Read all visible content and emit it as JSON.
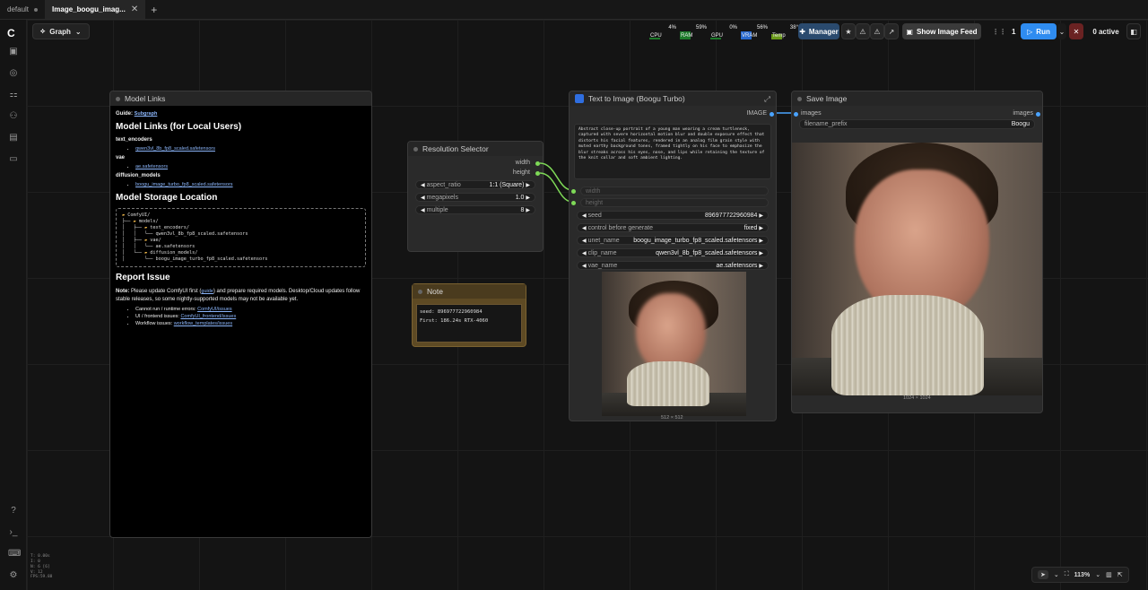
{
  "tabs": [
    {
      "label": "default",
      "active": false
    },
    {
      "label": "Image_boogu_imag...",
      "active": true
    }
  ],
  "toolbar": {
    "graph_label": "Graph",
    "stats": [
      {
        "label": "CPU",
        "pct": "4%",
        "fill": 0.04
      },
      {
        "label": "RAM",
        "pct": "59%",
        "fill": 0.59
      },
      {
        "label": "GPU",
        "pct": "0%",
        "fill": 0.0
      },
      {
        "label": "VRAM",
        "pct": "56%",
        "fill": 0.56
      },
      {
        "label": "Temp",
        "pct": "38°",
        "fill": 0.38
      }
    ],
    "manager_label": "Manager",
    "show_feed_label": "Show Image Feed",
    "batch_count": "1",
    "run_label": "Run",
    "active_label": "0 active"
  },
  "nodes": {
    "model_links": {
      "title": "Model Links",
      "guide_prefix": "Guide:",
      "guide_link": "Subgraph",
      "heading": "Model Links (for Local Users)",
      "sections": [
        {
          "name": "text_encoders",
          "files": [
            "qwen3vl_8b_fp8_scaled.safetensors"
          ]
        },
        {
          "name": "vae",
          "files": [
            "ae.safetensors"
          ]
        },
        {
          "name": "diffusion_models",
          "files": [
            "boogu_image_turbo_fp8_scaled.safetensors"
          ]
        }
      ],
      "storage_heading": "Model Storage Location",
      "tree": [
        "ComfyUI/",
        "├── models/",
        "│   ├── text_encoders/",
        "│   │   └── qwen3vl_8b_fp8_scaled.safetensors",
        "│   ├── vae/",
        "│   │   └── ae.safetensors",
        "│   └── diffusion_models/",
        "│       └── boogu_image_turbo_fp8_scaled.safetensors"
      ],
      "report_heading": "Report Issue",
      "note_label": "Note:",
      "note_text_1": "Please update ComfyUI first (",
      "note_link": "guide",
      "note_text_2": ") and prepare required models. Desktop/Cloud updates follow stable releases, so some nightly-supported models may not be available yet.",
      "issues": [
        {
          "label": "Cannot run / runtime errors:",
          "link": "ComfyUI/issues"
        },
        {
          "label": "UI / frontend issues:",
          "link": "ComfyUI_frontend/issues"
        },
        {
          "label": "Workflow issues:",
          "link": "workflow_templates/issues"
        }
      ]
    },
    "resolution": {
      "title": "Resolution Selector",
      "outputs": [
        "width",
        "height"
      ],
      "widgets": [
        {
          "label": "aspect_ratio",
          "value": "1:1 (Square)"
        },
        {
          "label": "megapixels",
          "value": "1.0"
        },
        {
          "label": "multiple",
          "value": "8"
        }
      ]
    },
    "note": {
      "title": "Note",
      "lines": [
        "seed: 896977722960984",
        "First: 186.24s  RTX-4060"
      ]
    },
    "text_to_image": {
      "title": "Text to Image (Boogu Turbo)",
      "output": "IMAGE",
      "prompt": "Abstract close-up portrait of a young man wearing a cream turtleneck, captured with severe horizontal motion blur and double exposure effect that distorts his facial features, rendered in an analog film grain style with muted earthy background tones, framed tightly on his face to emphasize the blur streaks across his eyes, nose, and lips while retaining the texture of the knit collar and soft ambient lighting.",
      "inputs": [
        "width",
        "height"
      ],
      "widgets": [
        {
          "label": "seed",
          "value": "896977722960984"
        },
        {
          "label": "control before generate",
          "value": "fixed"
        },
        {
          "label": "unet_name",
          "value": "boogu_image_turbo_fp8_scaled.safetensors"
        },
        {
          "label": "clip_name",
          "value": "qwen3vl_8b_fp8_scaled.safetensors"
        },
        {
          "label": "vae_name",
          "value": "ae.safetensors"
        }
      ],
      "caption": "512 × 512"
    },
    "save_image": {
      "title": "Save Image",
      "input": "images",
      "output": "images",
      "widgets": [
        {
          "label": "filename_prefix",
          "value": "Boogu"
        }
      ],
      "caption": "1024 × 1024"
    }
  },
  "fps": [
    "T: 0.00s",
    "I: 0",
    "N: 6 [6]",
    "V: 12",
    "FPS:59.88"
  ],
  "bottom_controls": {
    "zoom": "113%"
  },
  "colors": {
    "accent": "#2f8cf0",
    "link_green": "#7ed957",
    "link_blue": "#4aa3ff"
  }
}
